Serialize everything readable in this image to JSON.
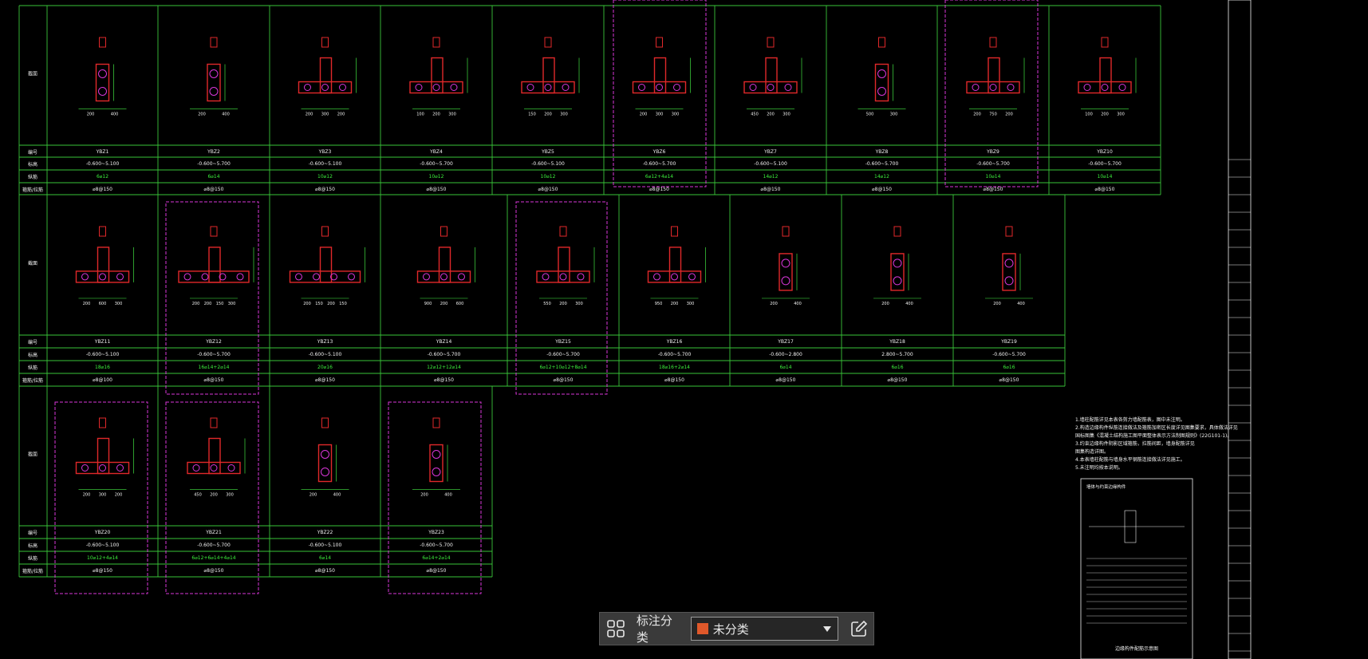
{
  "app": {
    "accent": "#e0582a",
    "line_color": "#39c439",
    "shape_color": "#e0282a",
    "dashed_color": "#d836d8"
  },
  "table": {
    "row_labels": {
      "section": "截面",
      "number": "编号",
      "elevation": "标高",
      "longitudinal": "纵筋",
      "stirrup": "箍筋/拉筋"
    },
    "rows": [
      {
        "cells": [
          {
            "dims": [
              "200",
              "400"
            ],
            "number": "YBZ1",
            "elevation": "-0.600~5.100",
            "rebar": "6⌀12",
            "stirrup": "⌀8@150"
          },
          {
            "dims": [
              "200",
              "400"
            ],
            "number": "YBZ2",
            "elevation": "-0.600~5.700",
            "rebar": "6⌀14",
            "stirrup": "⌀8@150"
          },
          {
            "dims": [
              "200",
              "300",
              "200"
            ],
            "number": "YBZ3",
            "elevation": "-0.600~5.100",
            "rebar": "10⌀12",
            "stirrup": "⌀8@150"
          },
          {
            "dims": [
              "100",
              "200",
              "300"
            ],
            "number": "YBZ4",
            "elevation": "-0.600~5.700",
            "rebar": "10⌀12",
            "stirrup": "⌀8@150"
          },
          {
            "dims": [
              "150",
              "200",
              "300"
            ],
            "number": "YBZ5",
            "elevation": "-0.600~5.100",
            "rebar": "10⌀12",
            "stirrup": "⌀8@150"
          },
          {
            "dims": [
              "200",
              "300",
              "300"
            ],
            "number": "YBZ6",
            "elevation": "-0.600~5.700",
            "rebar": "6⌀12+4⌀14",
            "stirrup": "⌀8@150"
          },
          {
            "dims": [
              "450",
              "200",
              "300"
            ],
            "number": "YBZ7",
            "elevation": "-0.600~5.100",
            "rebar": "14⌀12",
            "stirrup": "⌀8@150"
          },
          {
            "dims": [
              "500",
              "300"
            ],
            "number": "YBZ8",
            "elevation": "-0.600~5.700",
            "rebar": "14⌀12",
            "stirrup": "⌀8@150"
          },
          {
            "dims": [
              "200",
              "750",
              "200"
            ],
            "number": "YBZ9",
            "elevation": "-0.600~5.700",
            "rebar": "10⌀14",
            "stirrup": "⌀8@150"
          },
          {
            "dims": [
              "100",
              "200",
              "300"
            ],
            "number": "YBZ10",
            "elevation": "-0.600~5.700",
            "rebar": "10⌀14",
            "stirrup": "⌀8@150"
          }
        ]
      },
      {
        "cells": [
          {
            "dims": [
              "200",
              "600",
              "300"
            ],
            "number": "YBZ11",
            "elevation": "-0.600~5.100",
            "rebar": "18⌀16",
            "stirrup": "⌀8@100"
          },
          {
            "dims": [
              "200",
              "200",
              "150",
              "300"
            ],
            "number": "YBZ12",
            "elevation": "-0.600~5.700",
            "rebar": "16⌀14+2⌀14",
            "stirrup": "⌀8@150"
          },
          {
            "dims": [
              "200",
              "150",
              "200",
              "150"
            ],
            "number": "YBZ13",
            "elevation": "-0.600~5.100",
            "rebar": "20⌀16",
            "stirrup": "⌀8@150"
          },
          {
            "dims": [
              "900",
              "200",
              "600"
            ],
            "number": "YBZ14",
            "elevation": "-0.600~5.700",
            "rebar": "12⌀12+12⌀14",
            "stirrup": "⌀8@150"
          },
          {
            "dims": [
              "550",
              "200",
              "300"
            ],
            "number": "YBZ15",
            "elevation": "-0.600~5.700",
            "rebar": "6⌀12+10⌀12+8⌀14",
            "stirrup": "⌀8@150"
          },
          {
            "dims": [
              "950",
              "200",
              "300"
            ],
            "number": "YBZ16",
            "elevation": "-0.600~5.700",
            "rebar": "18⌀16+2⌀14",
            "stirrup": "⌀8@150"
          },
          {
            "dims": [
              "200",
              "400"
            ],
            "number": "YBZ17",
            "elevation": "-0.600~2.800",
            "rebar": "6⌀14",
            "stirrup": "⌀8@150"
          },
          {
            "dims": [
              "200",
              "400"
            ],
            "number": "YBZ18",
            "elevation": "2.800~5.700",
            "rebar": "6⌀16",
            "stirrup": "⌀8@150"
          },
          {
            "dims": [
              "200",
              "400"
            ],
            "number": "YBZ19",
            "elevation": "-0.600~5.700",
            "rebar": "6⌀16",
            "stirrup": "⌀8@150"
          }
        ]
      },
      {
        "cells": [
          {
            "dims": [
              "200",
              "300",
              "200"
            ],
            "number": "YBZ20",
            "elevation": "-0.600~5.100",
            "rebar": "10⌀12+4⌀14",
            "stirrup": "⌀8@150"
          },
          {
            "dims": [
              "450",
              "200",
              "300"
            ],
            "number": "YBZ21",
            "elevation": "-0.600~5.700",
            "rebar": "6⌀12+6⌀14+4⌀14",
            "stirrup": "⌀8@150"
          },
          {
            "dims": [
              "200",
              "400"
            ],
            "number": "YBZ22",
            "elevation": "-0.600~5.100",
            "rebar": "6⌀14",
            "stirrup": "⌀8@150"
          },
          {
            "dims": [
              "200",
              "400"
            ],
            "number": "YBZ23",
            "elevation": "-0.600~5.700",
            "rebar": "6⌀14+2⌀14",
            "stirrup": "⌀8@150"
          }
        ]
      }
    ]
  },
  "notes": {
    "lines": [
      "1.墙柱配筋详见本表各剪力墙配筋表，图中未注明。",
      "2.构造边缘构件纵筋连接做法及箍筋加密区长度详见图集要求，具体做法详见",
      "  国标图集《混凝土结构施工图平面整体表示方法制图规则》(22G101-1)。",
      "3.约束边缘构件阴影区域箍筋，拉筋间距，墙身配筋详见",
      "  图集构造详图。",
      "4.本表墙柱配筋与墙身水平钢筋连接做法详见施工。",
      "5.未注明均按本说明。"
    ],
    "detail_title": "墙体与约束边缘构件",
    "detail_caption": "边缘构件配筋示意图"
  },
  "bottom_toolbar": {
    "label": "标注分类",
    "selected": "未分类",
    "swatch_color": "#e0582a"
  }
}
